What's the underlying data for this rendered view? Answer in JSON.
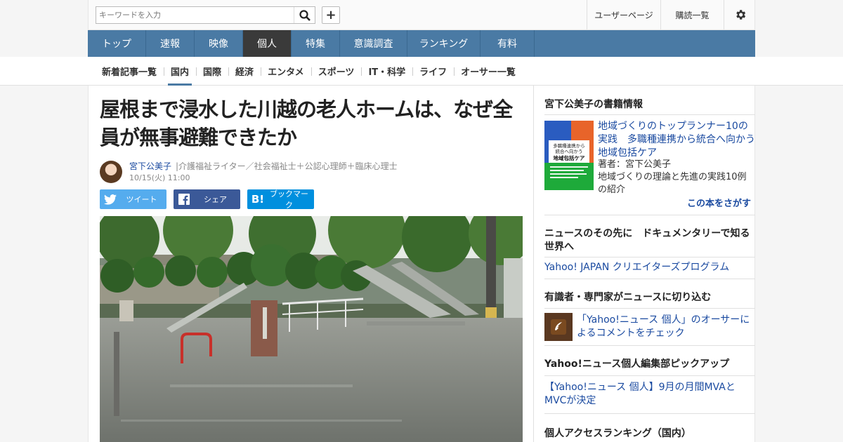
{
  "search": {
    "placeholder": "キーワードを入力"
  },
  "header": {
    "user_page": "ユーザーページ",
    "subscriptions": "購読一覧"
  },
  "main_nav": [
    {
      "label": "トップ",
      "active": false
    },
    {
      "label": "速報",
      "active": false
    },
    {
      "label": "映像",
      "active": false
    },
    {
      "label": "個人",
      "active": true
    },
    {
      "label": "特集",
      "active": false
    },
    {
      "label": "意識調査",
      "active": false
    },
    {
      "label": "ランキング",
      "active": false
    },
    {
      "label": "有料",
      "active": false
    }
  ],
  "sub_nav": [
    {
      "label": "新着記事一覧",
      "active": false
    },
    {
      "label": "国内",
      "active": true
    },
    {
      "label": "国際",
      "active": false
    },
    {
      "label": "経済",
      "active": false
    },
    {
      "label": "エンタメ",
      "active": false
    },
    {
      "label": "スポーツ",
      "active": false
    },
    {
      "label": "IT・科学",
      "active": false
    },
    {
      "label": "ライフ",
      "active": false
    },
    {
      "label": "オーサー一覧",
      "active": false
    }
  ],
  "article": {
    "title": "屋根まで浸水した川越の老人ホームは、なぜ全員が無事避難できたか",
    "author_name": "宮下公美子",
    "author_role": "|介護福祉ライター／社会福祉士＋公認心理師＋臨床心理士",
    "date": "10/15(火) 11:00",
    "share": {
      "tweet": "ツイート",
      "facebook": "シェア",
      "bookmark": "ブックマーク",
      "hatena_mark": "B!"
    }
  },
  "sidebar": {
    "book": {
      "heading": "宮下公美子の書籍情報",
      "title": "地域づくりのトップランナー10の実践　多職種連携から統合へ向かう地域包括ケア",
      "author": "著者：宮下公美子",
      "desc": "地域づくりの理論と先進の実践10例の紹介",
      "find_link": "この本をさがす",
      "cover_lines": [
        "多職種連携から",
        "統合へ向かう",
        "地域包括ケア"
      ]
    },
    "documentary": {
      "heading": "ニュースのその先に　ドキュメンタリーで知る世界へ",
      "link": "Yahoo! JAPAN クリエイターズプログラム"
    },
    "experts": {
      "heading": "有識者・専門家がニュースに切り込む",
      "link": "「Yahoo!ニュース 個人」のオーサーによるコメントをチェック"
    },
    "pickup": {
      "heading": "Yahoo!ニュース個人編集部ピックアップ",
      "link": "【Yahoo!ニュース 個人】9月の月間MVAとMVCが決定"
    },
    "ranking": {
      "heading": "個人アクセスランキング（国内）"
    }
  },
  "colors": {
    "nav_bg": "#4a7aa4",
    "nav_active": "#3a3a3a",
    "link": "#1a4aa0",
    "twitter": "#55acee",
    "facebook": "#3b5998",
    "hatena": "#008fde"
  }
}
